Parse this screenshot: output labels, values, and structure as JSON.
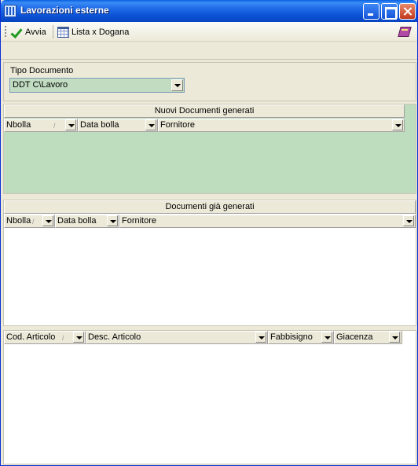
{
  "window": {
    "title": "Lavorazioni esterne"
  },
  "toolbar": {
    "avvia_label": "Avvia",
    "lista_label": "Lista x Dogana"
  },
  "tipo_documento": {
    "label": "Tipo Documento",
    "value": "DDT C\\Lavoro"
  },
  "new_docs": {
    "caption": "Nuovi Documenti generati",
    "columns": [
      "Nbolla",
      "Data bolla",
      "Fornitore"
    ]
  },
  "existing_docs": {
    "caption": "Documenti già generati",
    "columns": [
      "Nbolla",
      "Data bolla",
      "Fornitore"
    ]
  },
  "articles": {
    "columns": [
      "Cod. Articolo",
      "Desc. Articolo",
      "Fabbisigno",
      "Giacenza"
    ]
  },
  "colors": {
    "grid_green": "#bedcbe",
    "combo_green": "#c1dcc0",
    "titlebar_blue": "#0b53d6"
  },
  "icons": [
    "app-icon",
    "check-icon",
    "calendar-icon",
    "book-icon",
    "chevron-down-icon"
  ]
}
